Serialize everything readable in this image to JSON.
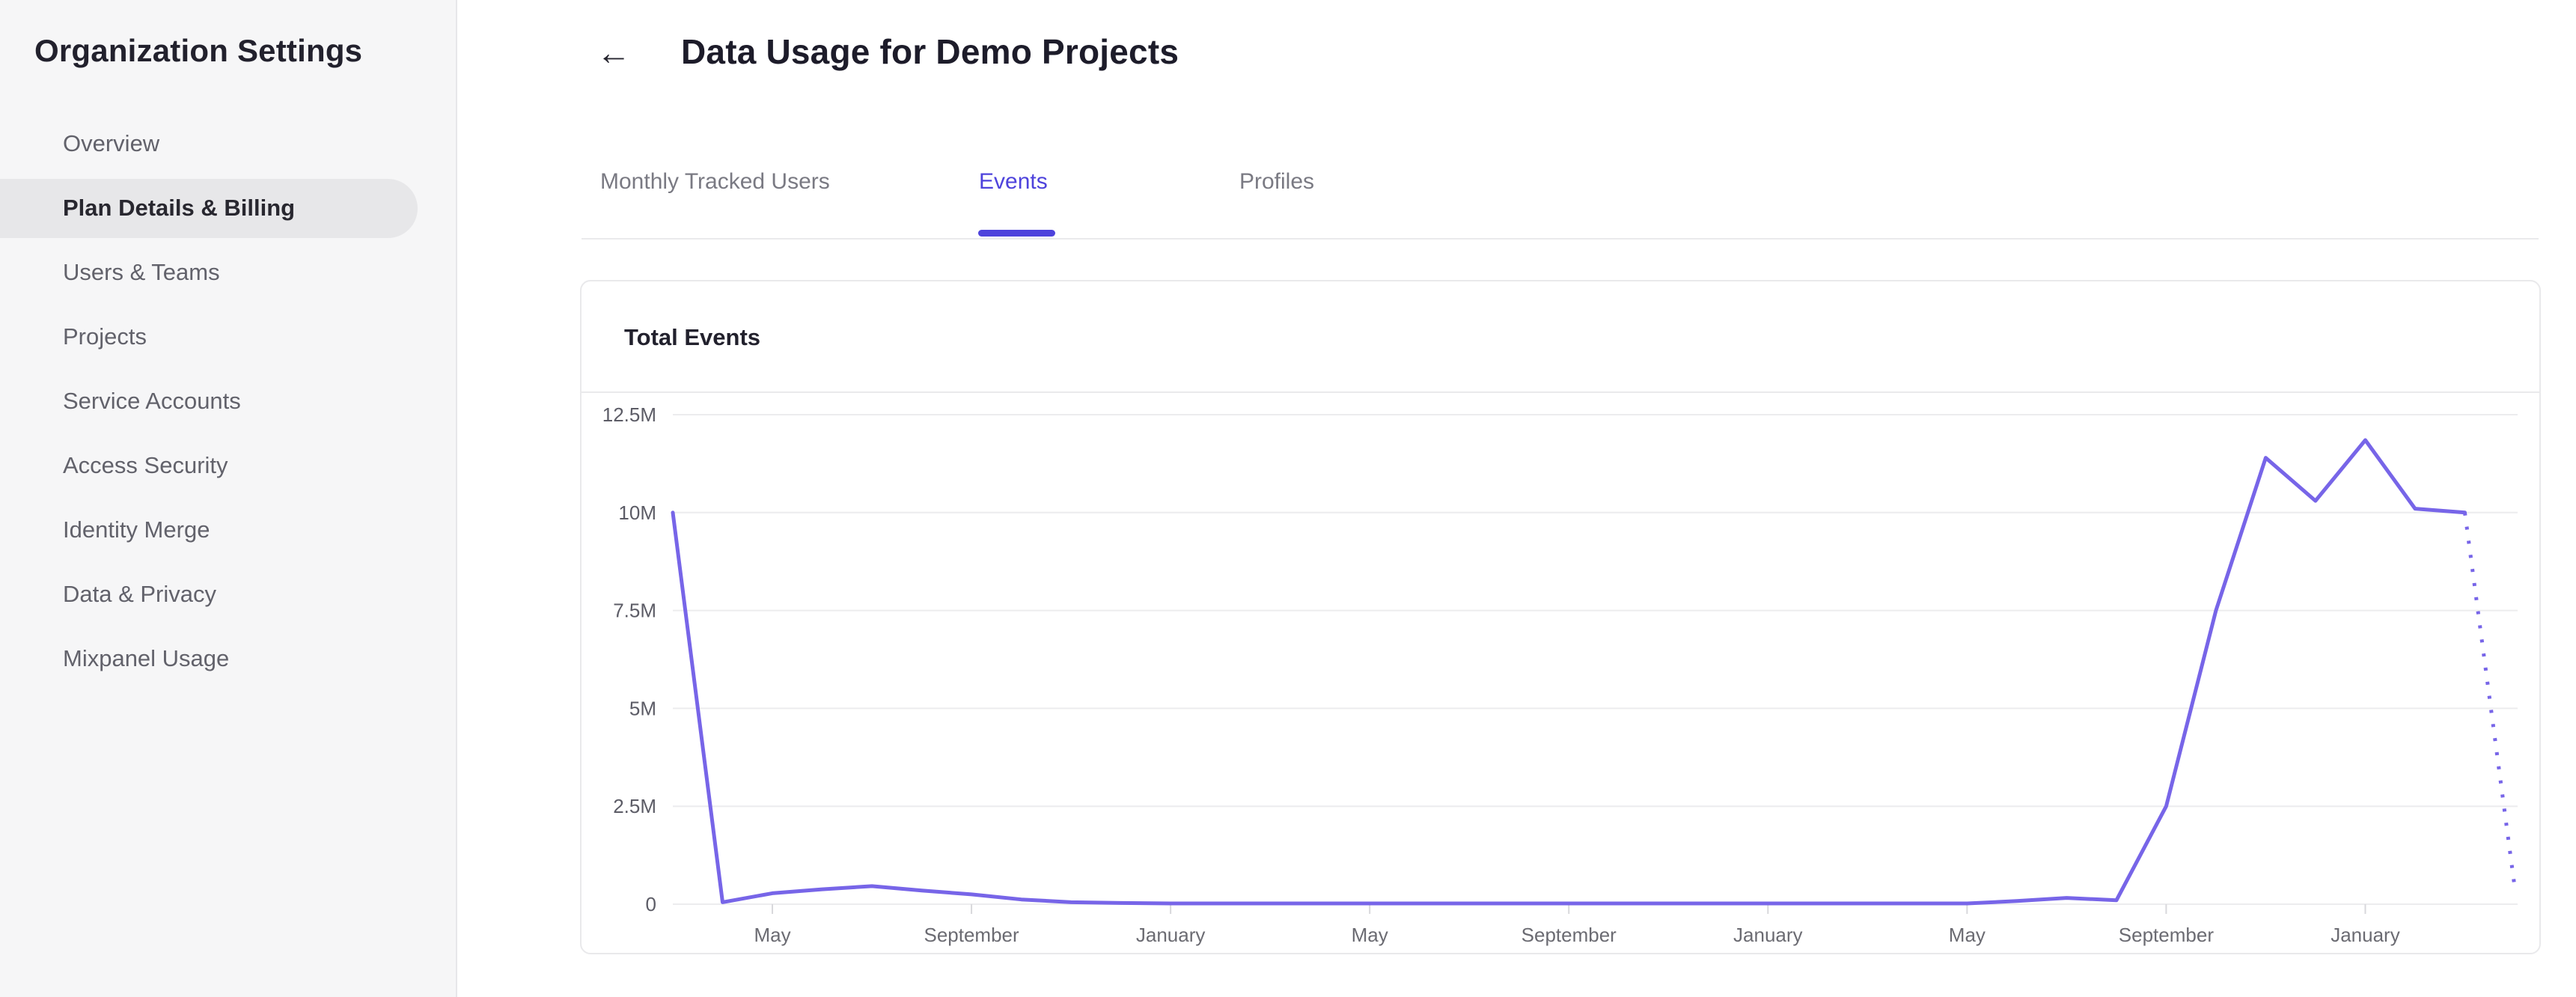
{
  "app": {
    "accent_color": "#4e43dc",
    "line_color": "#7765e8",
    "grid_color": "#ececee",
    "tick_color": "#d8d8dc",
    "axis_label_color": "#6b6b72"
  },
  "sidebar": {
    "title": "Organization Settings",
    "items": [
      {
        "label": "Overview",
        "selected": false
      },
      {
        "label": "Plan Details & Billing",
        "selected": true
      },
      {
        "label": "Users & Teams",
        "selected": false
      },
      {
        "label": "Projects",
        "selected": false
      },
      {
        "label": "Service Accounts",
        "selected": false
      },
      {
        "label": "Access Security",
        "selected": false
      },
      {
        "label": "Identity Merge",
        "selected": false
      },
      {
        "label": "Data & Privacy",
        "selected": false
      },
      {
        "label": "Mixpanel Usage",
        "selected": false
      }
    ]
  },
  "header": {
    "back_icon": "←",
    "title": "Data Usage for Demo Projects"
  },
  "tabs": [
    {
      "label": "Monthly Tracked Users",
      "active": false
    },
    {
      "label": "Events",
      "active": true
    },
    {
      "label": "Profiles",
      "active": false
    }
  ],
  "card": {
    "title": "Total Events"
  },
  "chart_data": {
    "type": "line",
    "title": "Total Events",
    "grid": "horizontal",
    "legend": "none",
    "x_axis": {
      "granularity": "month",
      "tick_labels": [
        "May",
        "September",
        "January",
        "May",
        "September",
        "January",
        "May",
        "September",
        "January"
      ],
      "tick_indices": [
        2,
        6,
        10,
        14,
        18,
        22,
        26,
        30,
        34
      ]
    },
    "y_axis": {
      "tick_labels": [
        "12.5M",
        "10M",
        "7.5M",
        "5M",
        "2.5M",
        "0"
      ],
      "lim_millions": [
        0,
        12.5
      ]
    },
    "series": [
      {
        "name": "Total Events",
        "unit": "events",
        "values_millions": [
          10.0,
          0.05,
          0.28,
          0.38,
          0.46,
          0.35,
          0.25,
          0.12,
          0.05,
          0.03,
          0.02,
          0.02,
          0.02,
          0.02,
          0.02,
          0.02,
          0.02,
          0.02,
          0.02,
          0.02,
          0.02,
          0.02,
          0.02,
          0.02,
          0.02,
          0.02,
          0.02,
          0.08,
          0.16,
          0.1,
          2.5,
          7.5,
          11.4,
          10.3,
          11.85,
          10.1,
          10.0,
          0.45
        ],
        "solid_through_index": 36,
        "projected_tail_style": "dotted"
      }
    ]
  }
}
